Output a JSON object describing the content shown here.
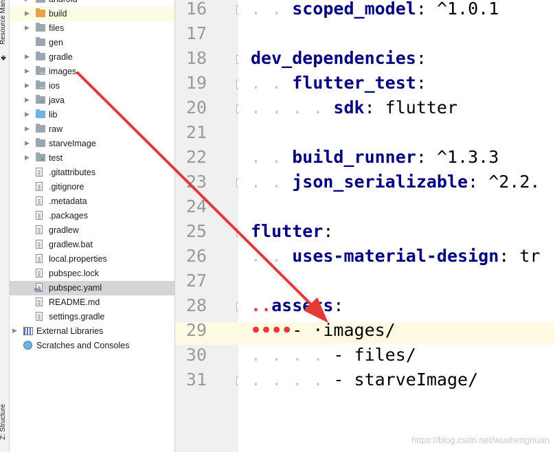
{
  "side_tabs": {
    "resource_manager": "Resource Man",
    "structure": "Z: Structure"
  },
  "tree": [
    {
      "label": "android",
      "type": "folder",
      "arrow": true,
      "indent": 1
    },
    {
      "label": "build",
      "type": "folder-orange",
      "arrow": true,
      "indent": 1
    },
    {
      "label": "files",
      "type": "folder",
      "arrow": true,
      "indent": 1
    },
    {
      "label": "gen",
      "type": "folder",
      "arrow": false,
      "indent": 1
    },
    {
      "label": "gradle",
      "type": "folder",
      "arrow": true,
      "indent": 1
    },
    {
      "label": "images",
      "type": "folder",
      "arrow": true,
      "indent": 1
    },
    {
      "label": "ios",
      "type": "folder",
      "arrow": true,
      "indent": 1
    },
    {
      "label": "java",
      "type": "folder",
      "arrow": true,
      "indent": 1
    },
    {
      "label": "lib",
      "type": "folder-blue",
      "arrow": true,
      "indent": 1
    },
    {
      "label": "raw",
      "type": "folder",
      "arrow": true,
      "indent": 1
    },
    {
      "label": "starveImage",
      "type": "folder",
      "arrow": true,
      "indent": 1
    },
    {
      "label": "test",
      "type": "folder-test",
      "arrow": true,
      "indent": 1
    },
    {
      "label": ".gitattributes",
      "type": "file",
      "arrow": false,
      "indent": 1
    },
    {
      "label": ".gitignore",
      "type": "file",
      "arrow": false,
      "indent": 1
    },
    {
      "label": ".metadata",
      "type": "file",
      "arrow": false,
      "indent": 1
    },
    {
      "label": ".packages",
      "type": "file",
      "arrow": false,
      "indent": 1
    },
    {
      "label": "gradlew",
      "type": "file",
      "arrow": false,
      "indent": 1
    },
    {
      "label": "gradlew.bat",
      "type": "file",
      "arrow": false,
      "indent": 1
    },
    {
      "label": "local.properties",
      "type": "file",
      "arrow": false,
      "indent": 1
    },
    {
      "label": "pubspec.lock",
      "type": "file",
      "arrow": false,
      "indent": 1
    },
    {
      "label": "pubspec.yaml",
      "type": "yaml",
      "arrow": false,
      "indent": 1,
      "selected": true
    },
    {
      "label": "README.md",
      "type": "md",
      "arrow": false,
      "indent": 1
    },
    {
      "label": "settings.gradle",
      "type": "gradle",
      "arrow": false,
      "indent": 1
    },
    {
      "label": "External Libraries",
      "type": "libs",
      "arrow": true,
      "indent": 0
    },
    {
      "label": "Scratches and Consoles",
      "type": "scratch",
      "arrow": false,
      "indent": 0
    }
  ],
  "editor": {
    "lines": [
      {
        "no": "16",
        "ws": ". . ",
        "key": "scoped_model",
        "rest": ": ^1.0.1",
        "fold": "open"
      },
      {
        "no": "17",
        "ws": "",
        "key": "",
        "rest": "",
        "fold": ""
      },
      {
        "no": "18",
        "ws": "",
        "key": "dev_dependencies",
        "rest": ":",
        "fold": "open"
      },
      {
        "no": "19",
        "ws": ". . ",
        "key": "flutter_test",
        "rest": ":",
        "fold": "open"
      },
      {
        "no": "20",
        "ws": ". . . . ",
        "key": "sdk",
        "rest": ": flutter",
        "fold": "close"
      },
      {
        "no": "21",
        "ws": "",
        "key": "",
        "rest": "",
        "fold": ""
      },
      {
        "no": "22",
        "ws": ". . ",
        "key": "build_runner",
        "rest": ": ^1.3.3",
        "fold": ""
      },
      {
        "no": "23",
        "ws": ". . ",
        "key": "json_serializable",
        "rest": ": ^2.2.",
        "fold": "close"
      },
      {
        "no": "24",
        "ws": "",
        "key": "",
        "rest": "",
        "fold": ""
      },
      {
        "no": "25",
        "ws": "",
        "key": "flutter",
        "rest": ":",
        "fold": "open"
      },
      {
        "no": "26",
        "ws": ". . ",
        "key": "uses-material-design",
        "rest": ": tr",
        "fold": ""
      },
      {
        "no": "27",
        "ws": "",
        "key": "",
        "rest": "",
        "fold": ""
      },
      {
        "no": "28",
        "ws": "..",
        "key": "assets",
        "rest": ":",
        "fold": "open",
        "redws": true
      },
      {
        "no": "29",
        "ws": "••••",
        "key": "",
        "rest": "- ·images/",
        "fold": "",
        "redws": true,
        "current": true
      },
      {
        "no": "30",
        "ws": ". . . . ",
        "key": "",
        "rest": "- files/",
        "fold": ""
      },
      {
        "no": "31",
        "ws": ". . . . ",
        "key": "",
        "rest": "- starveImage/",
        "fold": "close"
      }
    ]
  },
  "watermark": "https://blog.csdn.net/wushengnuan",
  "colors": {
    "key": "#000080",
    "arrow": "#e53935",
    "selection": "#d5d5d5",
    "current_line": "#fffae3"
  }
}
